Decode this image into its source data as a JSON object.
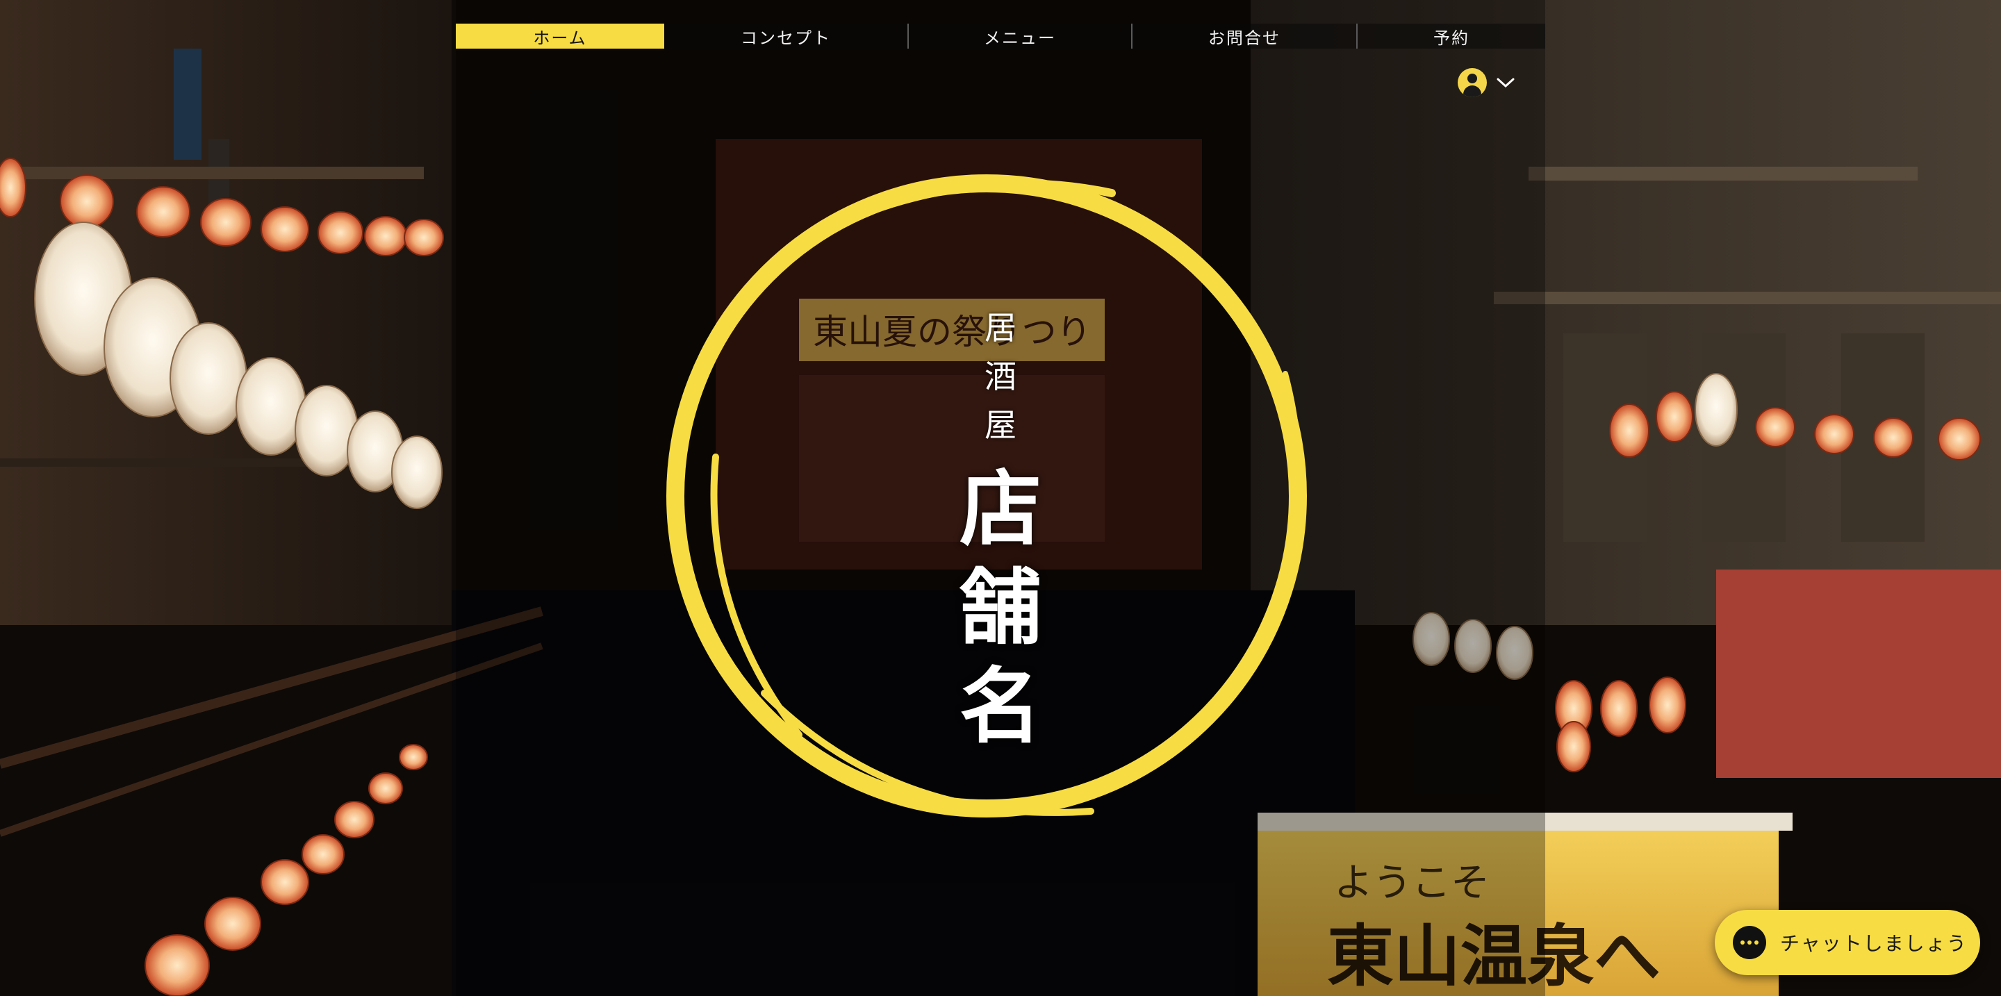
{
  "nav": {
    "items": [
      {
        "label": "ホーム",
        "active": true
      },
      {
        "label": "コンセプト",
        "active": false
      },
      {
        "label": "メニュー",
        "active": false
      },
      {
        "label": "お問合せ",
        "active": false
      },
      {
        "label": "予約",
        "active": false
      }
    ]
  },
  "account": {
    "icon": "user-avatar-icon",
    "menu_icon": "chevron-down-icon"
  },
  "hero": {
    "logo_small": [
      "居",
      "酒",
      "屋"
    ],
    "logo_large": [
      "店",
      "舗",
      "名"
    ],
    "photo_signs": {
      "stage_banner": "東山夏の祭りつり",
      "sign_top": "ようこそ",
      "sign_bottom": "東山温泉へ"
    }
  },
  "chat": {
    "label": "チャットしましょう",
    "icon": "chat-bubble-icon"
  },
  "colors": {
    "accent": "#f7dc43",
    "nav_bg": "#111111",
    "text_light": "#ffffff"
  }
}
